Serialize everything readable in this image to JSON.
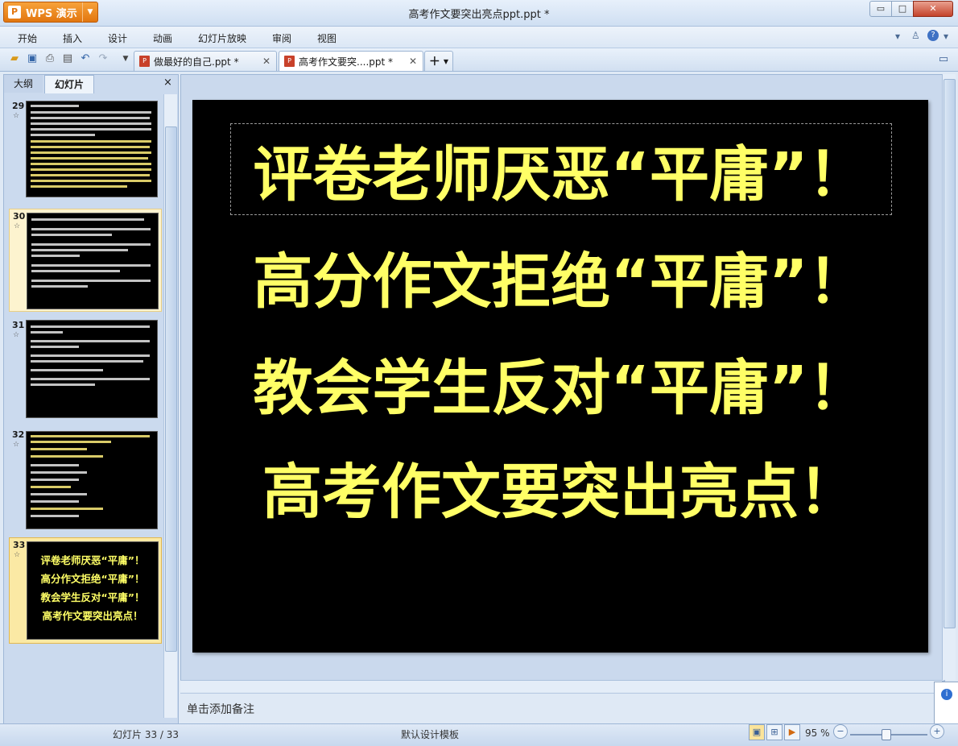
{
  "app": {
    "name": "WPS 演示",
    "logo_letter": "P",
    "window_title": "高考作文要突出亮点ppt.ppt *"
  },
  "window_controls": {
    "minimize": "▭",
    "maximize": "□",
    "close": "✕"
  },
  "menu": {
    "items": [
      "开始",
      "插入",
      "设计",
      "动画",
      "幻灯片放映",
      "审阅",
      "视图"
    ],
    "right_icons": [
      "chevron-down-icon",
      "shirt-icon",
      "help-icon"
    ]
  },
  "toolbar": {
    "icons": [
      "open-folder-icon",
      "save-icon",
      "print-icon",
      "print-preview-icon",
      "undo-icon",
      "redo-icon",
      "customize-icon"
    ]
  },
  "doc_tabs": [
    {
      "label": "做最好的自己.ppt *",
      "active": false
    },
    {
      "label": "高考作文要突....ppt *",
      "active": true
    }
  ],
  "left_panel": {
    "tabs": [
      "大纲",
      "幻灯片"
    ],
    "close": "×",
    "slides": [
      {
        "number": "29",
        "star": "☆",
        "kind": "dense"
      },
      {
        "number": "30",
        "star": "☆",
        "kind": "list"
      },
      {
        "number": "31",
        "star": "☆",
        "kind": "list"
      },
      {
        "number": "32",
        "star": "☆",
        "kind": "list"
      },
      {
        "number": "33",
        "star": "☆",
        "kind": "title",
        "lines": [
          "评卷老师厌恶“平庸”！",
          "高分作文拒绝“平庸”！",
          "教会学生反对“平庸”！",
          "高考作文要突出亮点！"
        ]
      }
    ]
  },
  "slide": {
    "lines": [
      "评卷老师厌恶“平庸”！",
      "高分作文拒绝“平庸”！",
      "教会学生反对“平庸”！",
      "高考作文要突出亮点！"
    ],
    "background": "#000000",
    "text_color": "#ffff66"
  },
  "notes": {
    "placeholder": "单击添加备注"
  },
  "status": {
    "slide_counter": "幻灯片 33 / 33",
    "template": "默认设计模板",
    "zoom": "95 %",
    "zoom_minus": "−",
    "zoom_plus": "+"
  },
  "colors": {
    "accent": "#e2760f",
    "panel": "#cbdaee",
    "selected": "#fbe9a4"
  }
}
